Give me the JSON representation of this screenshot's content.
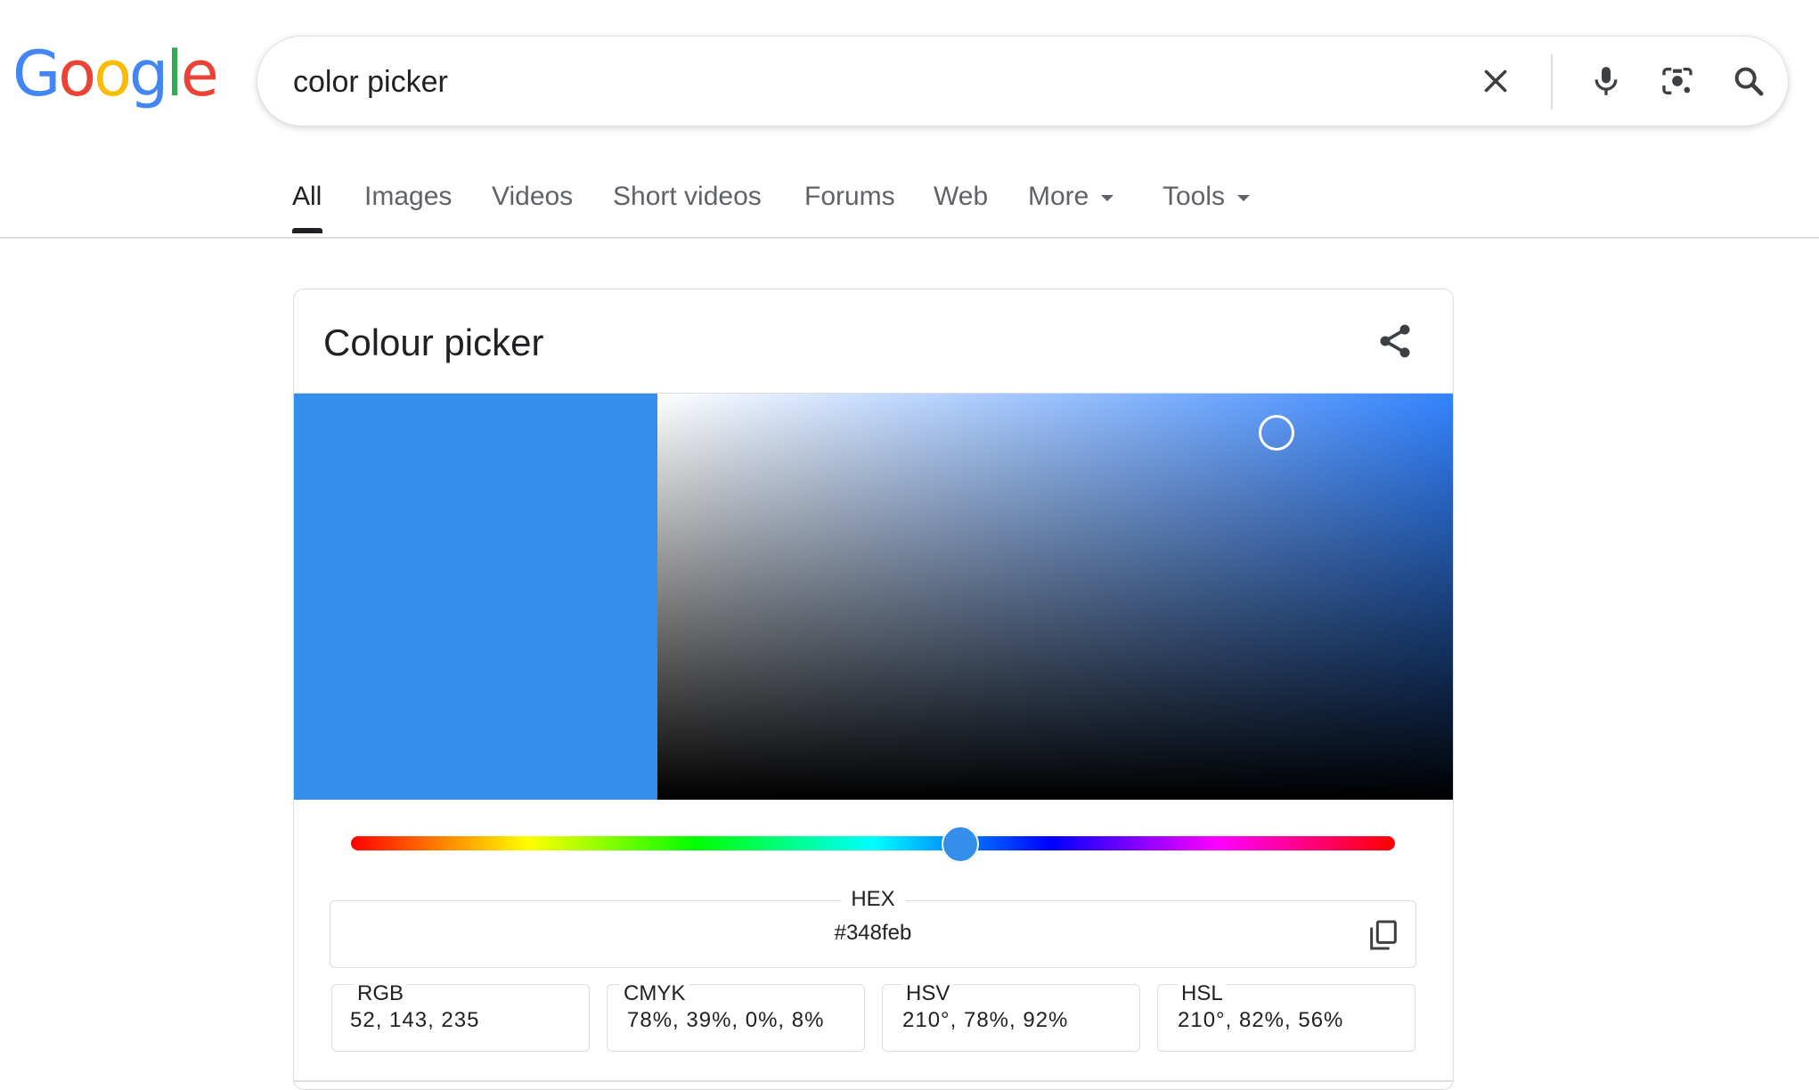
{
  "logo": {
    "letters": [
      "G",
      "o",
      "o",
      "g",
      "l",
      "e"
    ]
  },
  "search": {
    "query": "color picker"
  },
  "tabs": [
    {
      "label": "All",
      "active": true
    },
    {
      "label": "Images"
    },
    {
      "label": "Videos"
    },
    {
      "label": "Short videos"
    },
    {
      "label": "Forums"
    },
    {
      "label": "Web"
    },
    {
      "label": "More",
      "dropdown": true
    },
    {
      "label": "Tools",
      "dropdown": true
    }
  ],
  "widget": {
    "title": "Colour picker",
    "selected_color": "#348feb",
    "hue_color": "#3383ff",
    "hue_degrees": 210,
    "hex": {
      "label": "HEX",
      "value": "#348feb"
    },
    "formats": [
      {
        "label": "RGB",
        "value": "52, 143, 235"
      },
      {
        "label": "CMYK",
        "value": "78%, 39%, 0%, 8%"
      },
      {
        "label": "HSV",
        "value": "210°, 78%, 92%"
      },
      {
        "label": "HSL",
        "value": "210°, 82%, 56%"
      }
    ]
  },
  "icons": {
    "clear": "close-icon",
    "voice": "microphone-icon",
    "lens": "camera-lens-icon",
    "search": "search-icon",
    "share": "share-icon",
    "copy": "copy-icon"
  }
}
